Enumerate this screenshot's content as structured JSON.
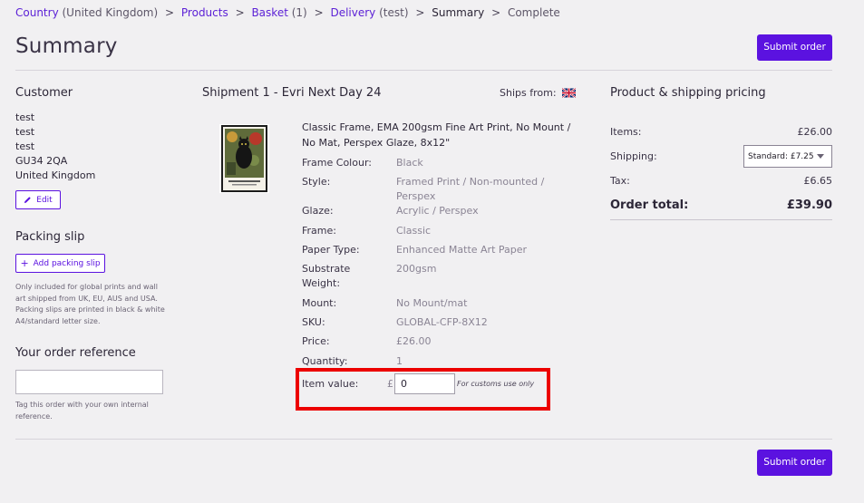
{
  "breadcrumb": {
    "country": "Country",
    "country_value": "(United Kingdom)",
    "products": "Products",
    "basket": "Basket",
    "basket_count": "(1)",
    "delivery": "Delivery",
    "delivery_value": "(test)",
    "summary": "Summary",
    "complete": "Complete",
    "separator": ">"
  },
  "page": {
    "title": "Summary",
    "submit_label": "Submit order"
  },
  "customer": {
    "heading": "Customer",
    "lines": [
      "test",
      "test",
      "test",
      "GU34 2QA",
      "United Kingdom"
    ],
    "edit_label": "Edit"
  },
  "packing": {
    "heading": "Packing slip",
    "add_label": "Add packing slip",
    "note": "Only included for global prints and wall art shipped from UK, EU, AUS and USA. Packing slips are printed in black & white A4/standard letter size."
  },
  "reference": {
    "heading": "Your order reference",
    "value": "",
    "note": "Tag this order with your own internal reference."
  },
  "shipment": {
    "title": "Shipment 1 - Evri Next Day 24",
    "ships_from": "Ships from:",
    "flag_icon": "uk-flag-icon",
    "product_name": "Classic Frame, EMA 200gsm Fine Art Print, No Mount / No Mat, Perspex Glaze, 8x12\"",
    "attributes": [
      {
        "label": "Frame Colour:",
        "value": "Black"
      },
      {
        "label": "Style:",
        "value": "Framed Print / Non-mounted / Perspex"
      },
      {
        "label": "Glaze:",
        "value": "Acrylic / Perspex"
      },
      {
        "label": "Frame:",
        "value": "Classic"
      },
      {
        "label": "Paper Type:",
        "value": "Enhanced Matte Art Paper"
      },
      {
        "label": "Substrate Weight:",
        "value": "200gsm"
      },
      {
        "label": "Mount:",
        "value": "No Mount/mat"
      },
      {
        "label": "SKU:",
        "value": "GLOBAL-CFP-8X12"
      },
      {
        "label": "Price:",
        "value": "£26.00"
      },
      {
        "label": "Quantity:",
        "value": "1"
      }
    ],
    "item_value_label": "Item value:",
    "currency": "£",
    "item_value": "0",
    "customs_note": "For customs use only"
  },
  "pricing": {
    "heading": "Product & shipping pricing",
    "items_label": "Items:",
    "items_value": "£26.00",
    "shipping_label": "Shipping:",
    "shipping_selected": "Standard: £7.25",
    "tax_label": "Tax:",
    "tax_value": "£6.65",
    "total_label": "Order total:",
    "total_value": "£39.90"
  },
  "colors": {
    "accent": "#5b12e0",
    "highlight": "#ec0000"
  }
}
